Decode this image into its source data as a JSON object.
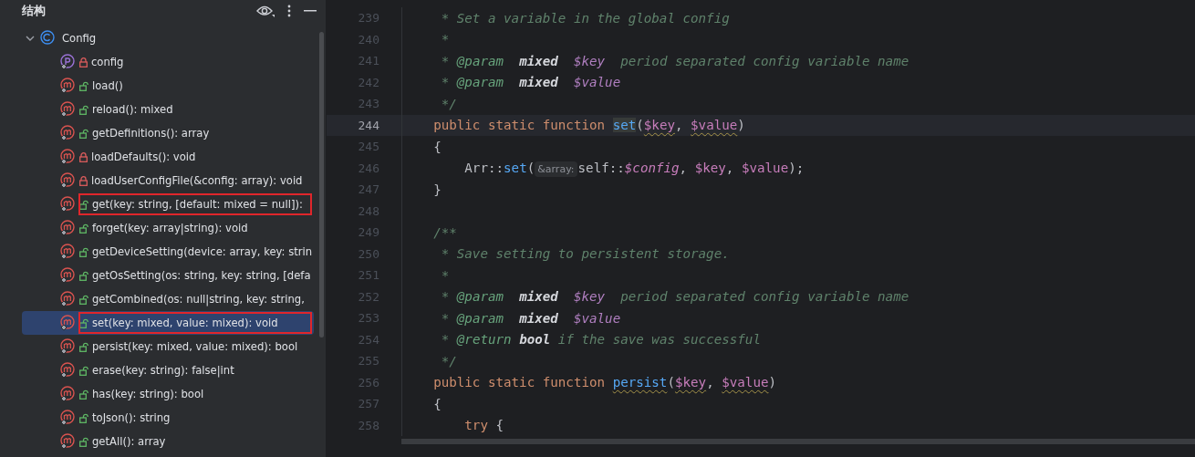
{
  "panel": {
    "title": "结构"
  },
  "tree": {
    "label": "Config",
    "kind": "class",
    "expanded": true,
    "children": [
      {
        "label": "config",
        "kind": "property",
        "private": true,
        "selected": false,
        "annotated": false
      },
      {
        "label": "load()",
        "kind": "method",
        "private": false,
        "selected": false,
        "annotated": false
      },
      {
        "label": "reload(): mixed",
        "kind": "method",
        "private": false,
        "selected": false,
        "annotated": false
      },
      {
        "label": "getDefinitions(): array",
        "kind": "method",
        "private": false,
        "selected": false,
        "annotated": false
      },
      {
        "label": "loadDefaults(): void",
        "kind": "method",
        "private": true,
        "selected": false,
        "annotated": false
      },
      {
        "label": "loadUserConfigFile(&config: array): void",
        "kind": "method",
        "private": true,
        "selected": false,
        "annotated": false
      },
      {
        "label": "get(key: string, [default: mixed = null]):",
        "kind": "method",
        "private": false,
        "selected": false,
        "annotated": true
      },
      {
        "label": "forget(key: array|string): void",
        "kind": "method",
        "private": false,
        "selected": false,
        "annotated": false
      },
      {
        "label": "getDeviceSetting(device: array, key: strin",
        "kind": "method",
        "private": false,
        "selected": false,
        "annotated": false
      },
      {
        "label": "getOsSetting(os: string, key: string, [defa",
        "kind": "method",
        "private": false,
        "selected": false,
        "annotated": false
      },
      {
        "label": "getCombined(os: null|string, key: string,",
        "kind": "method",
        "private": false,
        "selected": false,
        "annotated": false
      },
      {
        "label": "set(key: mixed, value: mixed): void",
        "kind": "method",
        "private": false,
        "selected": true,
        "annotated": true
      },
      {
        "label": "persist(key: mixed, value: mixed): bool",
        "kind": "method",
        "private": false,
        "selected": false,
        "annotated": false
      },
      {
        "label": "erase(key: string): false|int",
        "kind": "method",
        "private": false,
        "selected": false,
        "annotated": false
      },
      {
        "label": "has(key: string): bool",
        "kind": "method",
        "private": false,
        "selected": false,
        "annotated": false
      },
      {
        "label": "toJson(): string",
        "kind": "method",
        "private": false,
        "selected": false,
        "annotated": false
      },
      {
        "label": "getAll(): array",
        "kind": "method",
        "private": false,
        "selected": false,
        "annotated": false
      }
    ]
  },
  "editor": {
    "lines": [
      {
        "number": "239",
        "current": false,
        "tokens": [
          {
            "t": "     * Set a variable in the global config",
            "kind": "comment"
          }
        ]
      },
      {
        "number": "240",
        "current": false,
        "tokens": [
          {
            "t": "     *",
            "kind": "comment"
          }
        ]
      },
      {
        "number": "241",
        "current": false,
        "tokens": [
          {
            "t": "     * ",
            "kind": "comment"
          },
          {
            "t": "@param  ",
            "kind": "doctag"
          },
          {
            "t": "mixed  ",
            "kind": "doctype"
          },
          {
            "t": "$key",
            "kind": "docvar"
          },
          {
            "t": "  period separated config variable name",
            "kind": "comment"
          }
        ]
      },
      {
        "number": "242",
        "current": false,
        "tokens": [
          {
            "t": "     * ",
            "kind": "comment"
          },
          {
            "t": "@param  ",
            "kind": "doctag"
          },
          {
            "t": "mixed  ",
            "kind": "doctype"
          },
          {
            "t": "$value",
            "kind": "docvar"
          }
        ]
      },
      {
        "number": "243",
        "current": false,
        "tokens": [
          {
            "t": "     */",
            "kind": "comment"
          }
        ]
      },
      {
        "number": "244",
        "current": true,
        "tokens": [
          {
            "t": "    public static function ",
            "kind": "keyword"
          },
          {
            "t": "set",
            "kind": "fn-hl"
          },
          {
            "t": "(",
            "kind": "plain"
          },
          {
            "t": "$key",
            "kind": "var",
            "warn": true
          },
          {
            "t": ", ",
            "kind": "plain"
          },
          {
            "t": "$value",
            "kind": "var",
            "warn": true
          },
          {
            "t": ")",
            "kind": "plain"
          }
        ]
      },
      {
        "number": "245",
        "current": false,
        "tokens": [
          {
            "t": "    {",
            "kind": "plain"
          }
        ]
      },
      {
        "number": "246",
        "current": false,
        "tokens": [
          {
            "t": "        Arr::",
            "kind": "plain"
          },
          {
            "t": "set",
            "kind": "fn"
          },
          {
            "t": "(",
            "kind": "plain"
          },
          {
            "t": "&array:",
            "kind": "hint"
          },
          {
            "t": "self::",
            "kind": "plain"
          },
          {
            "t": "$config",
            "kind": "static"
          },
          {
            "t": ", ",
            "kind": "plain"
          },
          {
            "t": "$key",
            "kind": "var"
          },
          {
            "t": ", ",
            "kind": "plain"
          },
          {
            "t": "$value",
            "kind": "var"
          },
          {
            "t": ");",
            "kind": "plain"
          }
        ]
      },
      {
        "number": "247",
        "current": false,
        "tokens": [
          {
            "t": "    }",
            "kind": "plain"
          }
        ]
      },
      {
        "number": "248",
        "current": false
      },
      {
        "number": "249",
        "current": false,
        "tokens": [
          {
            "t": "    /**",
            "kind": "comment"
          }
        ]
      },
      {
        "number": "250",
        "current": false,
        "tokens": [
          {
            "t": "     * Save setting to persistent storage.",
            "kind": "comment"
          }
        ]
      },
      {
        "number": "251",
        "current": false,
        "tokens": [
          {
            "t": "     *",
            "kind": "comment"
          }
        ]
      },
      {
        "number": "252",
        "current": false,
        "tokens": [
          {
            "t": "     * ",
            "kind": "comment"
          },
          {
            "t": "@param  ",
            "kind": "doctag"
          },
          {
            "t": "mixed  ",
            "kind": "doctype"
          },
          {
            "t": "$key",
            "kind": "docvar"
          },
          {
            "t": "  period separated config variable name",
            "kind": "comment"
          }
        ]
      },
      {
        "number": "253",
        "current": false,
        "tokens": [
          {
            "t": "     * ",
            "kind": "comment"
          },
          {
            "t": "@param  ",
            "kind": "doctag"
          },
          {
            "t": "mixed  ",
            "kind": "doctype"
          },
          {
            "t": "$value",
            "kind": "docvar"
          }
        ]
      },
      {
        "number": "254",
        "current": false,
        "tokens": [
          {
            "t": "     * ",
            "kind": "comment"
          },
          {
            "t": "@return ",
            "kind": "doctag"
          },
          {
            "t": "bool",
            "kind": "doctype"
          },
          {
            "t": " if the save was successful",
            "kind": "comment"
          }
        ]
      },
      {
        "number": "255",
        "current": false,
        "tokens": [
          {
            "t": "     */",
            "kind": "comment"
          }
        ]
      },
      {
        "number": "256",
        "current": false,
        "tokens": [
          {
            "t": "    public static function ",
            "kind": "keyword"
          },
          {
            "t": "persist",
            "kind": "fn",
            "warn": true
          },
          {
            "t": "(",
            "kind": "plain"
          },
          {
            "t": "$key",
            "kind": "var",
            "warn": true
          },
          {
            "t": ", ",
            "kind": "plain"
          },
          {
            "t": "$value",
            "kind": "var",
            "warn": true
          },
          {
            "t": ")",
            "kind": "plain"
          }
        ]
      },
      {
        "number": "257",
        "current": false,
        "tokens": [
          {
            "t": "    {",
            "kind": "plain"
          }
        ]
      },
      {
        "number": "258",
        "current": false,
        "tokens": [
          {
            "t": "        try",
            "kind": "keyword"
          },
          {
            "t": " {",
            "kind": "plain"
          }
        ]
      }
    ]
  }
}
